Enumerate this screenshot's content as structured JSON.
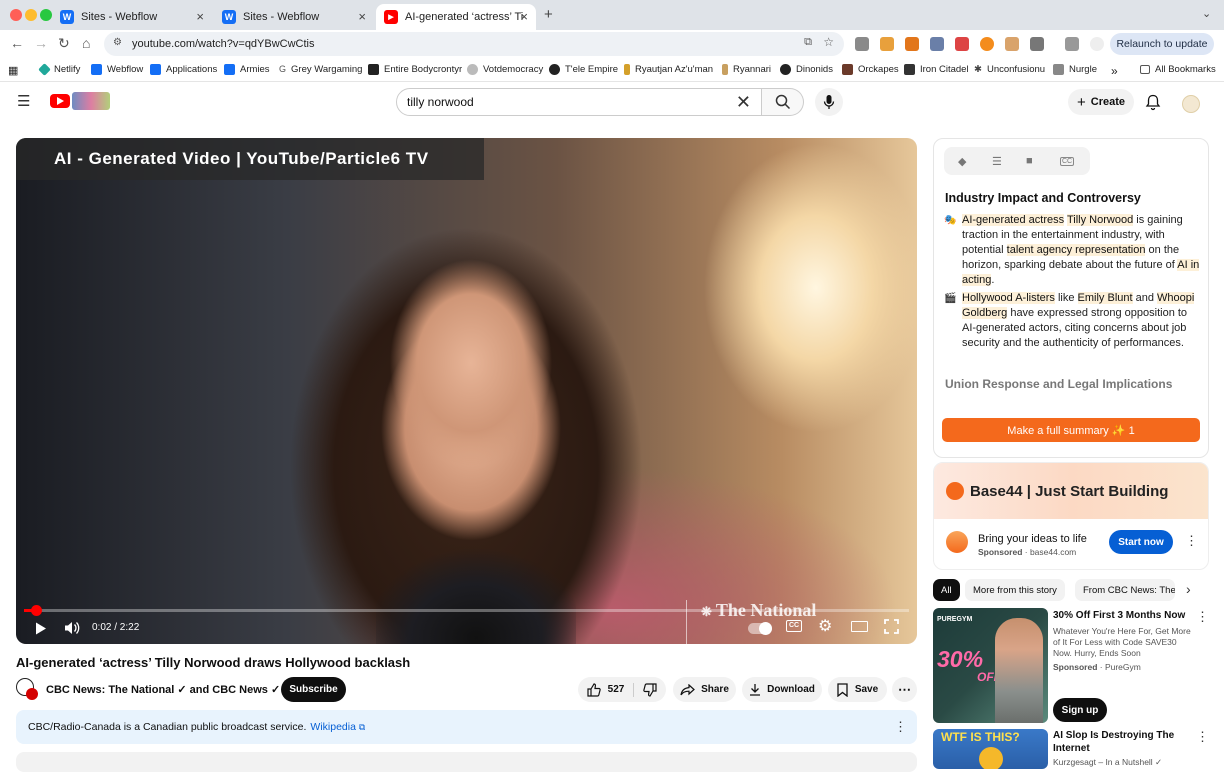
{
  "browser": {
    "tabs": [
      {
        "title": "Sites - Webflow",
        "favicon": "W"
      },
      {
        "title": "Sites - Webflow",
        "favicon": "W"
      },
      {
        "title": "AI-generated ‘actress’ Tilly N",
        "favicon": "▶"
      }
    ],
    "new_tab": "+",
    "url": "youtube.com/watch?v=qdYBwCwCtis",
    "relaunch": "Relaunch to update",
    "bookmarks": [
      "Netlify",
      "Webflow",
      "Applications",
      "Armies",
      "Grey Wargaming",
      "Entire Bodycrontyr",
      "Votdemocracy",
      "T'ele Empire",
      "Ryautjan Az'u'man",
      "Ryannari",
      "Dinonids",
      "Orckapes",
      "Iron Citadel",
      "Unconfusionu",
      "Nurgle"
    ],
    "all_bookmarks": "All Bookmarks",
    "more_bookmarks": "»"
  },
  "youtube": {
    "search_value": "tilly norwood",
    "create_label": "Create"
  },
  "video": {
    "banner": "AI - Generated Video | YouTube/Particle6 TV",
    "watermark": "The National",
    "time": "0:02 / 2:22",
    "progress_fraction": 0.014,
    "title": "AI-generated ‘actress’ Tilly Norwood draws Hollywood backlash",
    "channel": "CBC News: The National ✓ and CBC News ✓",
    "subscribe": "Subscribe",
    "likes": "527",
    "share": "Share",
    "download": "Download",
    "save": "Save",
    "more": "⋯",
    "description": "CBC/Radio-Canada is a Canadian public broadcast service.",
    "description_link": "Wikipedia"
  },
  "summary": {
    "heading": "Industry Impact and Controversy",
    "bullet1_pre": "",
    "bullet1_h1": "AI-generated actress",
    "bullet1_t1": " ",
    "bullet1_h2": "Tilly Norwood",
    "bullet1_t2": " is gaining traction in the entertainment industry, with potential ",
    "bullet1_h3": "talent agency representation",
    "bullet1_t3": " on the horizon, sparking debate about the future of ",
    "bullet1_h4": "AI in acting",
    "bullet1_t4": ".",
    "bullet2_h1": "Hollywood A-listers",
    "bullet2_t1": " like ",
    "bullet2_h2": "Emily Blunt",
    "bullet2_t2": " and ",
    "bullet2_h3": "Whoopi Goldberg",
    "bullet2_t3": " have expressed strong opposition to AI-generated actors, citing concerns about job security and the authenticity of performances.",
    "heading2": "Union Response and Legal Implications",
    "full_summary": "Make a full summary ✨ 1"
  },
  "ad": {
    "banner": "Base44  |  Just Start Building",
    "title": "Bring your ideas to life",
    "sponsored": "Sponsored",
    "domain": " · base44.com",
    "cta": "Start now"
  },
  "chips": [
    "All",
    "More from this story",
    "From CBC News: The"
  ],
  "recs": [
    {
      "title": "30% Off First 3 Months Now",
      "desc": "Whatever You're Here For, Get More of It For Less with Code SAVE30 Now. Hurry, Ends Soon",
      "sponsor": "Sponsored",
      "sponsor_name": " · PureGym",
      "cta": "Sign up",
      "thumb_text": "30%",
      "thumb_text2": "OFF",
      "thumb_brand": "PUREGYM"
    },
    {
      "title": "AI Slop Is Destroying The Internet",
      "channel": "Kurzgesagt – In a Nutshell ✓",
      "thumb_text": "WTF IS THIS?"
    }
  ],
  "colors": {
    "youtube_red": "#ff0000",
    "accent_orange": "#f4691c",
    "link_blue": "#065fd4",
    "highlight": "#fdf0d8"
  }
}
